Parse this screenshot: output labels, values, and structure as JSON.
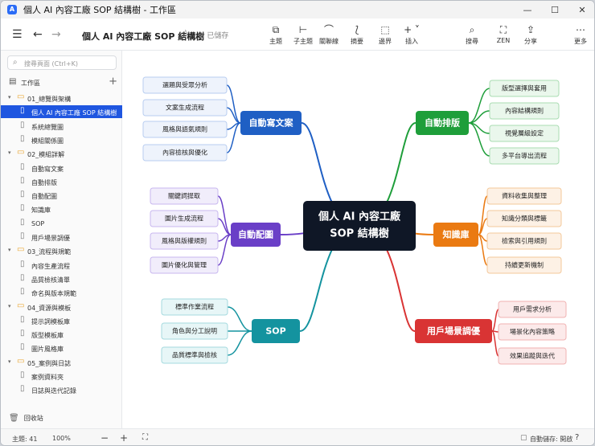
{
  "window": {
    "title": "個人 AI 內容工廠 SOP 結構樹 - 工作區",
    "app_icon_letter": "A",
    "buttons": [
      "—",
      "☐",
      "✕"
    ]
  },
  "toolbar": {
    "doc_title": "個人 AI 內容工廠 SOP 結構樹",
    "saved": "已儲存",
    "tools": [
      "主題",
      "子主題",
      "關聯線",
      "摘要",
      "邊界",
      "插入"
    ],
    "right_tools": [
      "搜尋",
      "ZEN",
      "分享",
      "更多"
    ]
  },
  "sidebar": {
    "search_placeholder": "搜尋頁面 (Ctrl+K)",
    "workspace": "工作區",
    "items": [
      {
        "label": "01_總覽與架構",
        "type": "folder"
      },
      {
        "label": "個人 AI 內容工廠 SOP 結構樹",
        "type": "doc",
        "selected": true
      },
      {
        "label": "系統總覽圖",
        "type": "doc"
      },
      {
        "label": "模組關係圖",
        "type": "doc"
      },
      {
        "label": "02_模組詳解",
        "type": "folder"
      },
      {
        "label": "自動寫文案",
        "type": "doc"
      },
      {
        "label": "自動排版",
        "type": "doc"
      },
      {
        "label": "自動配圖",
        "type": "doc"
      },
      {
        "label": "知識庫",
        "type": "doc"
      },
      {
        "label": "SOP",
        "type": "doc"
      },
      {
        "label": "用戶場景調優",
        "type": "doc"
      },
      {
        "label": "03_流程與規範",
        "type": "folder"
      },
      {
        "label": "內容生產流程",
        "type": "doc"
      },
      {
        "label": "品質檢核清單",
        "type": "doc"
      },
      {
        "label": "命名與版本規範",
        "type": "doc"
      },
      {
        "label": "04_資源與模板",
        "type": "folder"
      },
      {
        "label": "提示詞模板庫",
        "type": "doc"
      },
      {
        "label": "版型模板庫",
        "type": "doc"
      },
      {
        "label": "圖片風格庫",
        "type": "doc"
      },
      {
        "label": "05_案例與日誌",
        "type": "folder"
      },
      {
        "label": "案例資料夾",
        "type": "doc"
      },
      {
        "label": "日誌與迭代記錄",
        "type": "doc"
      }
    ],
    "trash": "回收站"
  },
  "mindmap": {
    "root": {
      "line1": "個人 AI 內容工廠",
      "line2": "SOP 結構樹"
    },
    "branches": [
      {
        "label": "自動寫文案",
        "color": "#1f5fc4",
        "leaf_bg": "#eef3fc",
        "leaf_border": "#b8cdf0",
        "children": [
          "選題與受眾分析",
          "文案生成流程",
          "風格與語氣規則",
          "內容檢核與優化"
        ]
      },
      {
        "label": "自動排版",
        "color": "#1e9e3a",
        "leaf_bg": "#eaf7ec",
        "leaf_border": "#a9dcb2",
        "children": [
          "版型選擇與套用",
          "內容結構規則",
          "視覺層級設定",
          "多平台導出流程"
        ]
      },
      {
        "label": "自動配圖",
        "color": "#6a3fc7",
        "leaf_bg": "#f1edfb",
        "leaf_border": "#c8b7ef",
        "children": [
          "關鍵詞提取",
          "圖片生成流程",
          "風格與版權規則",
          "圖片優化與管理"
        ]
      },
      {
        "label": "知識庫",
        "color": "#ea7a12",
        "leaf_bg": "#fdf1e5",
        "leaf_border": "#f3c89a",
        "children": [
          "資料收集與整理",
          "知識分類與標籤",
          "檢索與引用規則",
          "持續更新機制"
        ]
      },
      {
        "label": "SOP",
        "color": "#14939f",
        "leaf_bg": "#e7f6f7",
        "leaf_border": "#a5dadf",
        "children": [
          "標準作業流程",
          "角色與分工說明",
          "品質標準與檢核"
        ]
      },
      {
        "label": "用戶場景調優",
        "color": "#d93434",
        "leaf_bg": "#fceaea",
        "leaf_border": "#f0b2b2",
        "children": [
          "用戶需求分析",
          "場景化內容策略",
          "效果追蹤與迭代"
        ]
      }
    ]
  },
  "status": {
    "topics": "主題: 41",
    "zoom": "100%",
    "autosave": "自動儲存: 開啟"
  }
}
